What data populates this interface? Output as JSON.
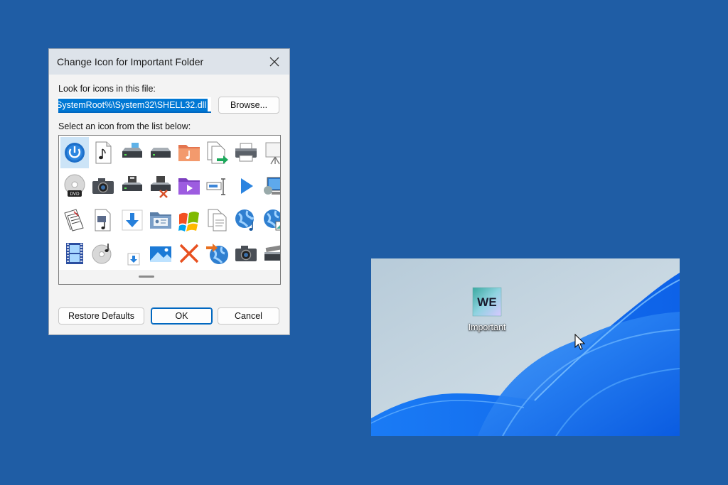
{
  "dialog": {
    "title": "Change Icon for Important Folder",
    "file_label": "Look for icons in this file:",
    "file_path": "SystemRoot%\\System32\\SHELL32.dll",
    "browse_label": "Browse...",
    "list_label": "Select an icon from the list below:",
    "restore_label": "Restore Defaults",
    "ok_label": "OK",
    "cancel_label": "Cancel"
  },
  "icons": [
    [
      "power-icon",
      "music-file-icon",
      "drive-icon",
      "drive-icon",
      "media-folder-icon",
      "move-file-icon",
      "printer-icon",
      "projector-icon"
    ],
    [
      "dvd-icon",
      "camera-icon",
      "floppy-drive-icon",
      "drive-removed-icon",
      "video-folder-icon",
      "rename-field-icon",
      "play-icon",
      "display-settings-icon"
    ],
    [
      "documents-icon",
      "media-file-icon",
      "download-arrow-icon",
      "contacts-folder-icon",
      "windows-logo-icon",
      "copy-icon",
      "internet-music-icon",
      "internet-picture-icon"
    ],
    [
      "film-strip-icon",
      "cd-music-icon",
      "small-download-icon",
      "pictures-icon",
      "red-x-icon",
      "globe-arrow-icon",
      "camera-icon",
      "scanner-icon"
    ]
  ],
  "desktop": {
    "folder_label": "Important",
    "icon_text": "WE"
  }
}
